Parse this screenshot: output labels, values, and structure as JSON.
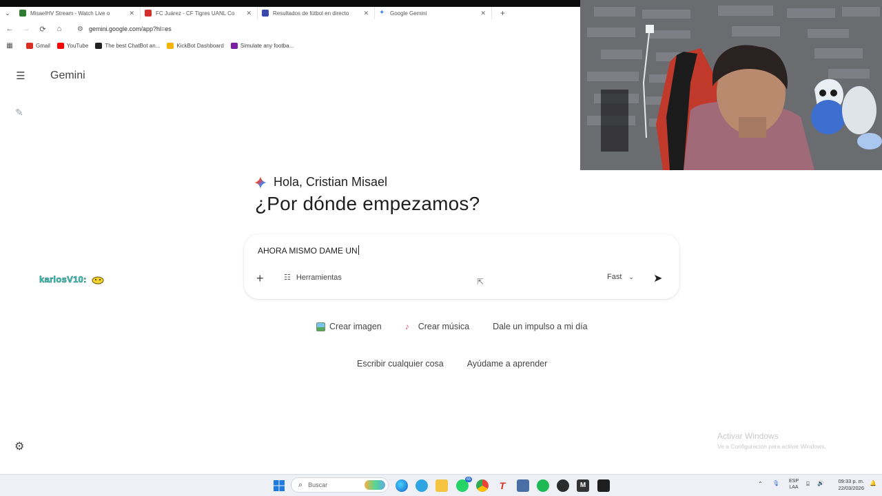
{
  "browser": {
    "tabs": [
      {
        "title": "MisaelHV Stream - Watch Live o",
        "favicon_color": "#2e7d32",
        "active": false
      },
      {
        "title": "FC Juárez - CF Tigres UANL Co",
        "favicon_color": "#d32f2f",
        "active": false
      },
      {
        "title": "Resultados de fútbol en directo",
        "favicon_color": "#3949ab",
        "active": false
      },
      {
        "title": "Google Gemini",
        "favicon_color": "#4285f4",
        "active": true
      }
    ],
    "url": "gemini.google.com/app?hl=es",
    "bookmarks": [
      {
        "label": "Gmail",
        "color": "#d93025"
      },
      {
        "label": "YouTube",
        "color": "#ff0000"
      },
      {
        "label": "The best ChatBot an...",
        "color": "#222222"
      },
      {
        "label": "KickBot Dashboard",
        "color": "#f4b400"
      },
      {
        "label": "Simulate any footba...",
        "color": "#7b1fa2"
      }
    ]
  },
  "app": {
    "name": "Gemini",
    "greeting": "Hola, Cristian Misael",
    "headline": "¿Por dónde empezamos?",
    "prompt_value": "AHORA MISMO DAME UN",
    "tools_label": "Herramientas",
    "model_label": "Fast",
    "suggestions_row1": [
      {
        "label": "Crear imagen",
        "icon": "image-icon"
      },
      {
        "label": "Crear música",
        "icon": "guitar-icon"
      },
      {
        "label": "Dale un impulso a mi día",
        "icon": ""
      }
    ],
    "suggestions_row2": [
      {
        "label": "Escribir cualquier cosa"
      },
      {
        "label": "Ayúdame a aprender"
      }
    ]
  },
  "overlay": {
    "chat_user": "karlosV10:"
  },
  "watermark": {
    "line1": "Activar Windows",
    "line2": "Ve a Configuración para activar Windows."
  },
  "taskbar": {
    "search_placeholder": "Buscar",
    "whatsapp_badge": "65",
    "lang_line1": "ESP",
    "lang_line2": "LAA",
    "time": "09:33 p. m.",
    "date": "22/03/2026"
  }
}
